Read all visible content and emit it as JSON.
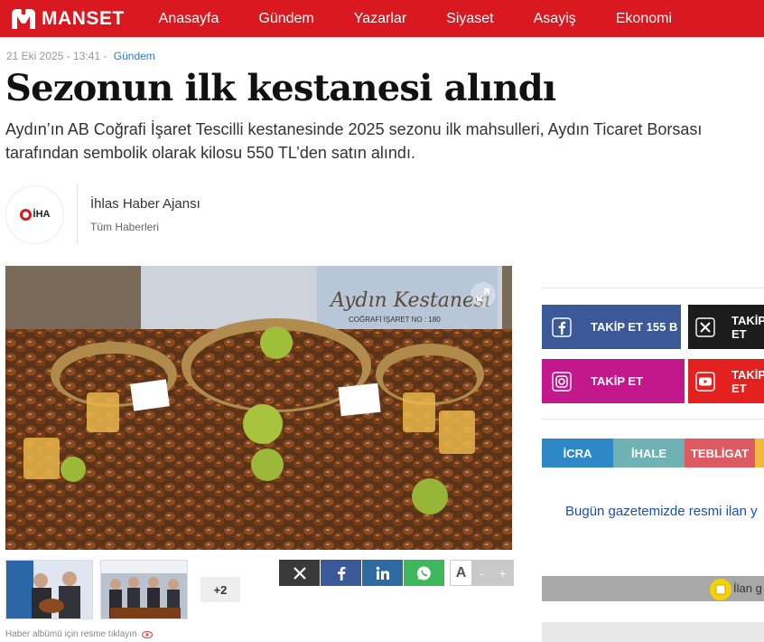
{
  "brand": {
    "name": "MANSET",
    "color": "#d9191f"
  },
  "nav": [
    "Anasayfa",
    "Gündem",
    "Yazarlar",
    "Siyaset",
    "Asayiş",
    "Ekonomi"
  ],
  "article": {
    "date": "21 Eki 2025 - 13:41",
    "separator": "-",
    "category": "Gündem",
    "title": "Sezonun ilk kestanesi alındı",
    "summary": "Aydın’ın AB Coğrafi İşaret Tescilli kestanesinde 2025 sezonu ilk mahsulleri, Aydın Ticaret Borsası tarafından sembolik olarak kilosu 550 TL’den satın alındı."
  },
  "author": {
    "logo_text": "İHA",
    "name": "İhlas Haber Ajansı",
    "link": "Tüm Haberleri"
  },
  "image": {
    "sign_text": "Aydın Kestanesi",
    "sign_sub": "COĞRAFİ İŞARET NO : 180",
    "expand_icon": "expand-icon"
  },
  "gallery": {
    "more_label": "+2",
    "hint": "Haber albümü için resme tıklayın",
    "hint_icon": "eye-icon"
  },
  "share": [
    {
      "name": "x",
      "icon": "x-icon",
      "color": "#3a3a3a"
    },
    {
      "name": "facebook",
      "icon": "facebook-icon",
      "color": "#3b5998"
    },
    {
      "name": "linkedin",
      "icon": "linkedin-icon",
      "color": "#2f6aa3"
    },
    {
      "name": "whatsapp",
      "icon": "whatsapp-icon",
      "color": "#3db85a"
    }
  ],
  "font_controls": {
    "a": "A",
    "minus": "-",
    "plus": "+"
  },
  "sidebar": {
    "social": [
      {
        "label": "TAKİP ET 155 B",
        "icon": "facebook-icon",
        "color": "#3b5998"
      },
      {
        "label": "TAKİP ET",
        "icon": "x-icon",
        "color": "#1c1c1c"
      },
      {
        "label": "TAKİP ET",
        "icon": "instagram-icon",
        "color": "#c2188c"
      },
      {
        "label": "TAKİP ET",
        "icon": "youtube-icon",
        "color": "#e3211f"
      }
    ],
    "tabs": [
      {
        "label": "İCRA",
        "color": "#2f88c6"
      },
      {
        "label": "İHALE",
        "color": "#6fb2b4"
      },
      {
        "label": "TEBLİGAT",
        "color": "#de5a62"
      },
      {
        "label": "",
        "color": "#f3b93f"
      }
    ],
    "ilan_link": "Bugün gazetemizde resmi ilan y",
    "ilan_text": "İlan g"
  }
}
